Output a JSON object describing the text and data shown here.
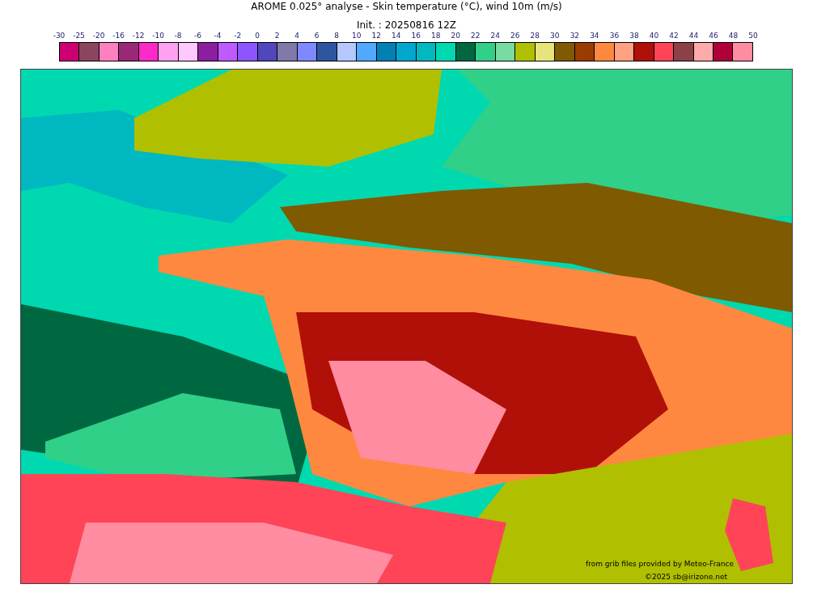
{
  "title": "AROME 0.025° analyse - Skin temperature (°C), wind 10m (m/s)",
  "subtitle": "Init. : 20250816 12Z",
  "colorbar": {
    "ticks": [
      "-30",
      "-25",
      "-20",
      "-16",
      "-12",
      "-10",
      "-8",
      "-6",
      "-4",
      "-2",
      "0",
      "2",
      "4",
      "6",
      "8",
      "10",
      "12",
      "14",
      "16",
      "18",
      "20",
      "22",
      "24",
      "26",
      "28",
      "30",
      "32",
      "34",
      "36",
      "38",
      "40",
      "42",
      "44",
      "46",
      "48",
      "50"
    ],
    "swatches": [
      {
        "color": "#cc0073"
      },
      {
        "color": "#8b4560"
      },
      {
        "color": "#ff80c0"
      },
      {
        "color": "#9a2878"
      },
      {
        "color": "#ff28c8"
      },
      {
        "color": "#ffa0f0"
      },
      {
        "color": "#ffc8ff"
      },
      {
        "color": "#8c1ea0"
      },
      {
        "color": "#be5aff"
      },
      {
        "color": "#8c55ff"
      },
      {
        "color": "#5046be"
      },
      {
        "color": "#7f7aa8"
      },
      {
        "color": "#8088ff"
      },
      {
        "color": "#2e55a0"
      },
      {
        "color": "#b4c8ff"
      },
      {
        "color": "#50a8ff"
      },
      {
        "color": "#0080b4"
      },
      {
        "color": "#00a8d0"
      },
      {
        "color": "#00b8c0"
      },
      {
        "color": "#00d8b0"
      },
      {
        "color": "#006840"
      },
      {
        "color": "#30d088"
      },
      {
        "color": "#78dca0"
      },
      {
        "color": "#b0c000"
      },
      {
        "color": "#e6e47a"
      },
      {
        "color": "#7f5a00"
      },
      {
        "color": "#9a3c00"
      },
      {
        "color": "#ff8840"
      },
      {
        "color": "#ffa080"
      },
      {
        "color": "#b01008"
      },
      {
        "color": "#ff4458"
      },
      {
        "color": "#8c4048"
      },
      {
        "color": "#ffaaaa"
      },
      {
        "color": "#b00038"
      },
      {
        "color": "#ff8ca0"
      }
    ]
  },
  "credits": [
    "from grib files provided by Meteo-France",
    "©2025 sb@irizone.net"
  ]
}
